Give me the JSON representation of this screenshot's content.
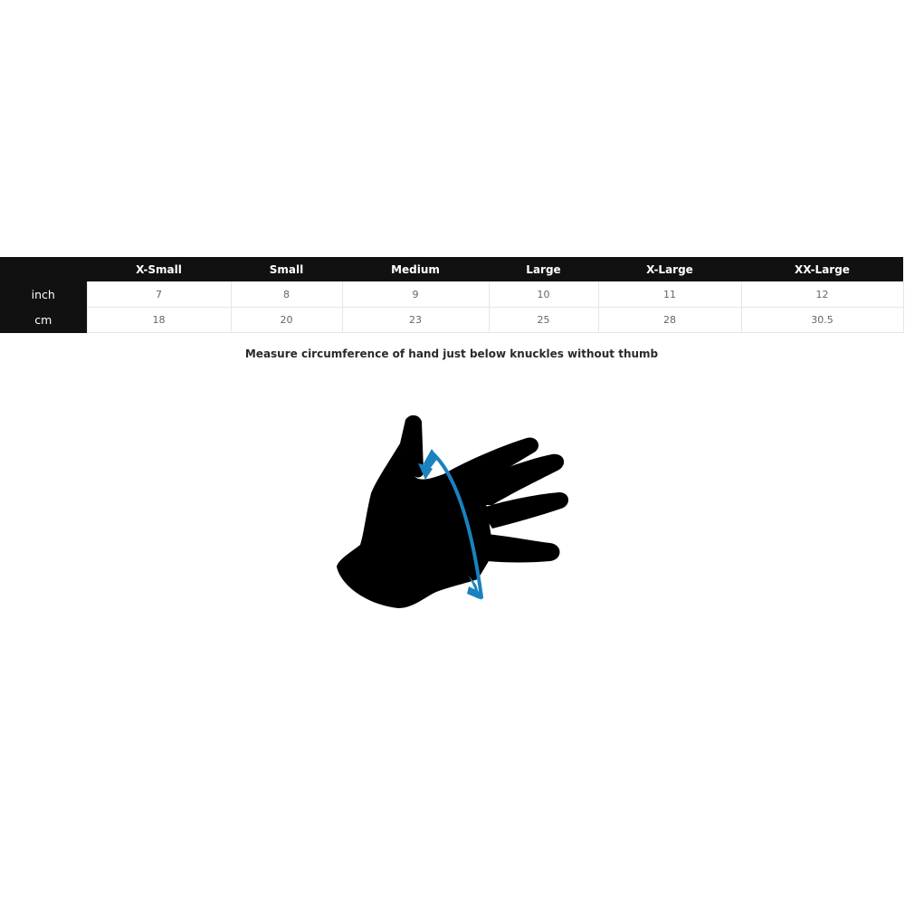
{
  "size_chart": {
    "corner_label": "",
    "sizes": [
      "X-Small",
      "Small",
      "Medium",
      "Large",
      "X-Large",
      "XX-Large"
    ],
    "rows": [
      {
        "unit": "inch",
        "values": [
          "7",
          "8",
          "9",
          "10",
          "11",
          "12"
        ]
      },
      {
        "unit": "cm",
        "values": [
          "18",
          "20",
          "23",
          "25",
          "28",
          "30.5"
        ]
      }
    ]
  },
  "instruction": "Measure circumference of hand just below knuckles without thumb",
  "illustration": {
    "name": "hand-measurement-icon",
    "hand_color": "#000000",
    "arrow_color": "#1a82be"
  }
}
